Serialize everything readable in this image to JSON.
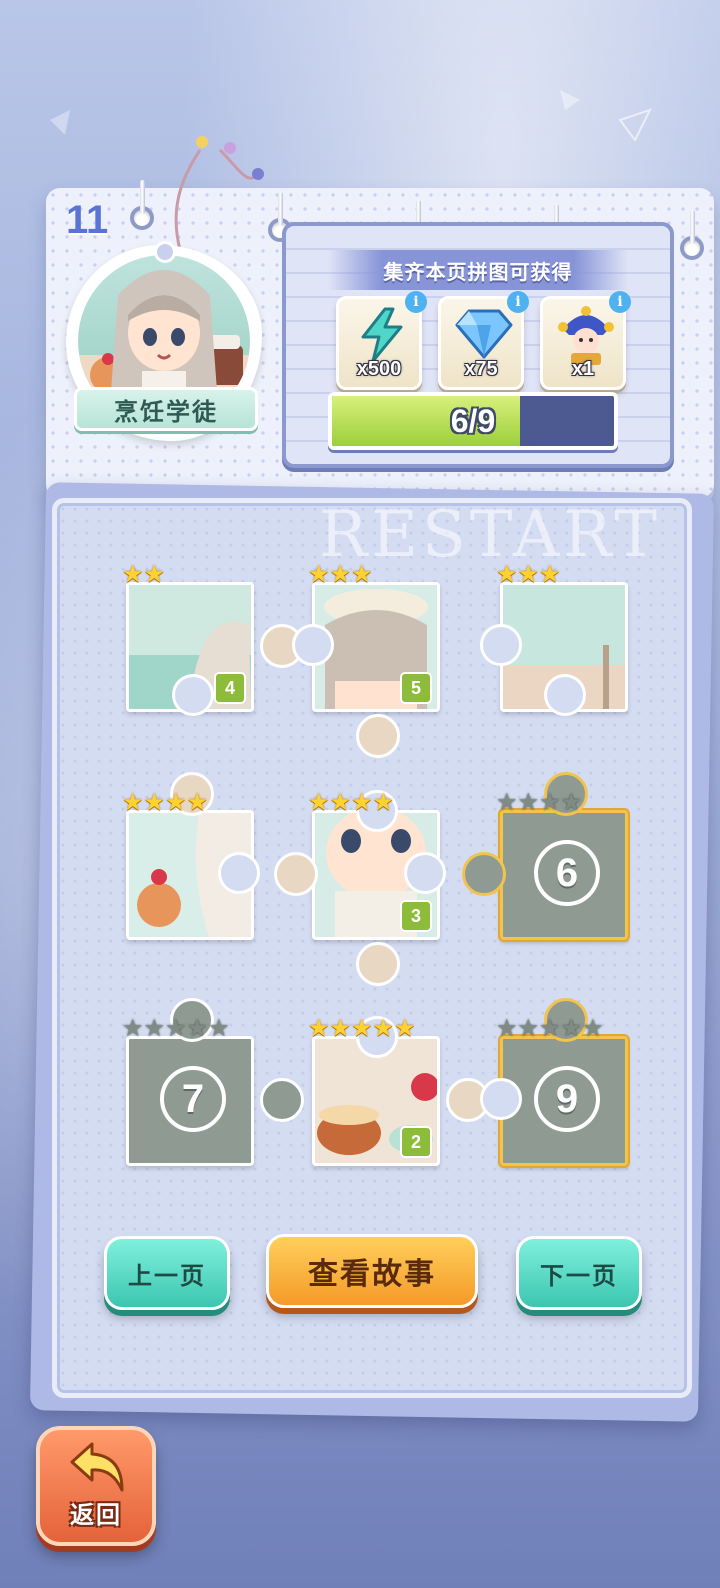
{
  "level": {
    "number": "11"
  },
  "character": {
    "title": "烹饪学徒"
  },
  "reward": {
    "title": "集齐本页拼图可获得",
    "items": [
      {
        "icon": "lightning-icon",
        "qty": "x500"
      },
      {
        "icon": "diamond-icon",
        "qty": "x75"
      },
      {
        "icon": "jester-icon",
        "qty": "x1"
      }
    ],
    "info_glyph": "i",
    "progress": {
      "text": "6/9",
      "current": 6,
      "total": 9
    }
  },
  "board": {
    "watermark": "RESTART",
    "pieces": [
      {
        "slot": 1,
        "label": "4",
        "stars": 2,
        "state": "filled"
      },
      {
        "slot": 2,
        "label": "5",
        "stars": 3,
        "state": "filled"
      },
      {
        "slot": 3,
        "label": "",
        "stars": 3,
        "state": "filled"
      },
      {
        "slot": 4,
        "label": "",
        "stars": 4,
        "state": "filled"
      },
      {
        "slot": 5,
        "label": "3",
        "stars": 4,
        "state": "filled"
      },
      {
        "slot": 6,
        "label": "6",
        "stars": 4,
        "state": "locked"
      },
      {
        "slot": 7,
        "label": "7",
        "stars": 5,
        "state": "locked"
      },
      {
        "slot": 8,
        "label": "2",
        "stars": 5,
        "state": "filled"
      },
      {
        "slot": 9,
        "label": "9",
        "stars": 5,
        "state": "locked"
      }
    ]
  },
  "nav": {
    "prev_label": "上一页",
    "story_label": "查看故事",
    "next_label": "下一页"
  },
  "back": {
    "label": "返回"
  },
  "colors": {
    "teal": "#3cc6b1",
    "orange": "#f59a2a",
    "progress_fill": "#9ccf3a",
    "star": "#ffd230"
  }
}
